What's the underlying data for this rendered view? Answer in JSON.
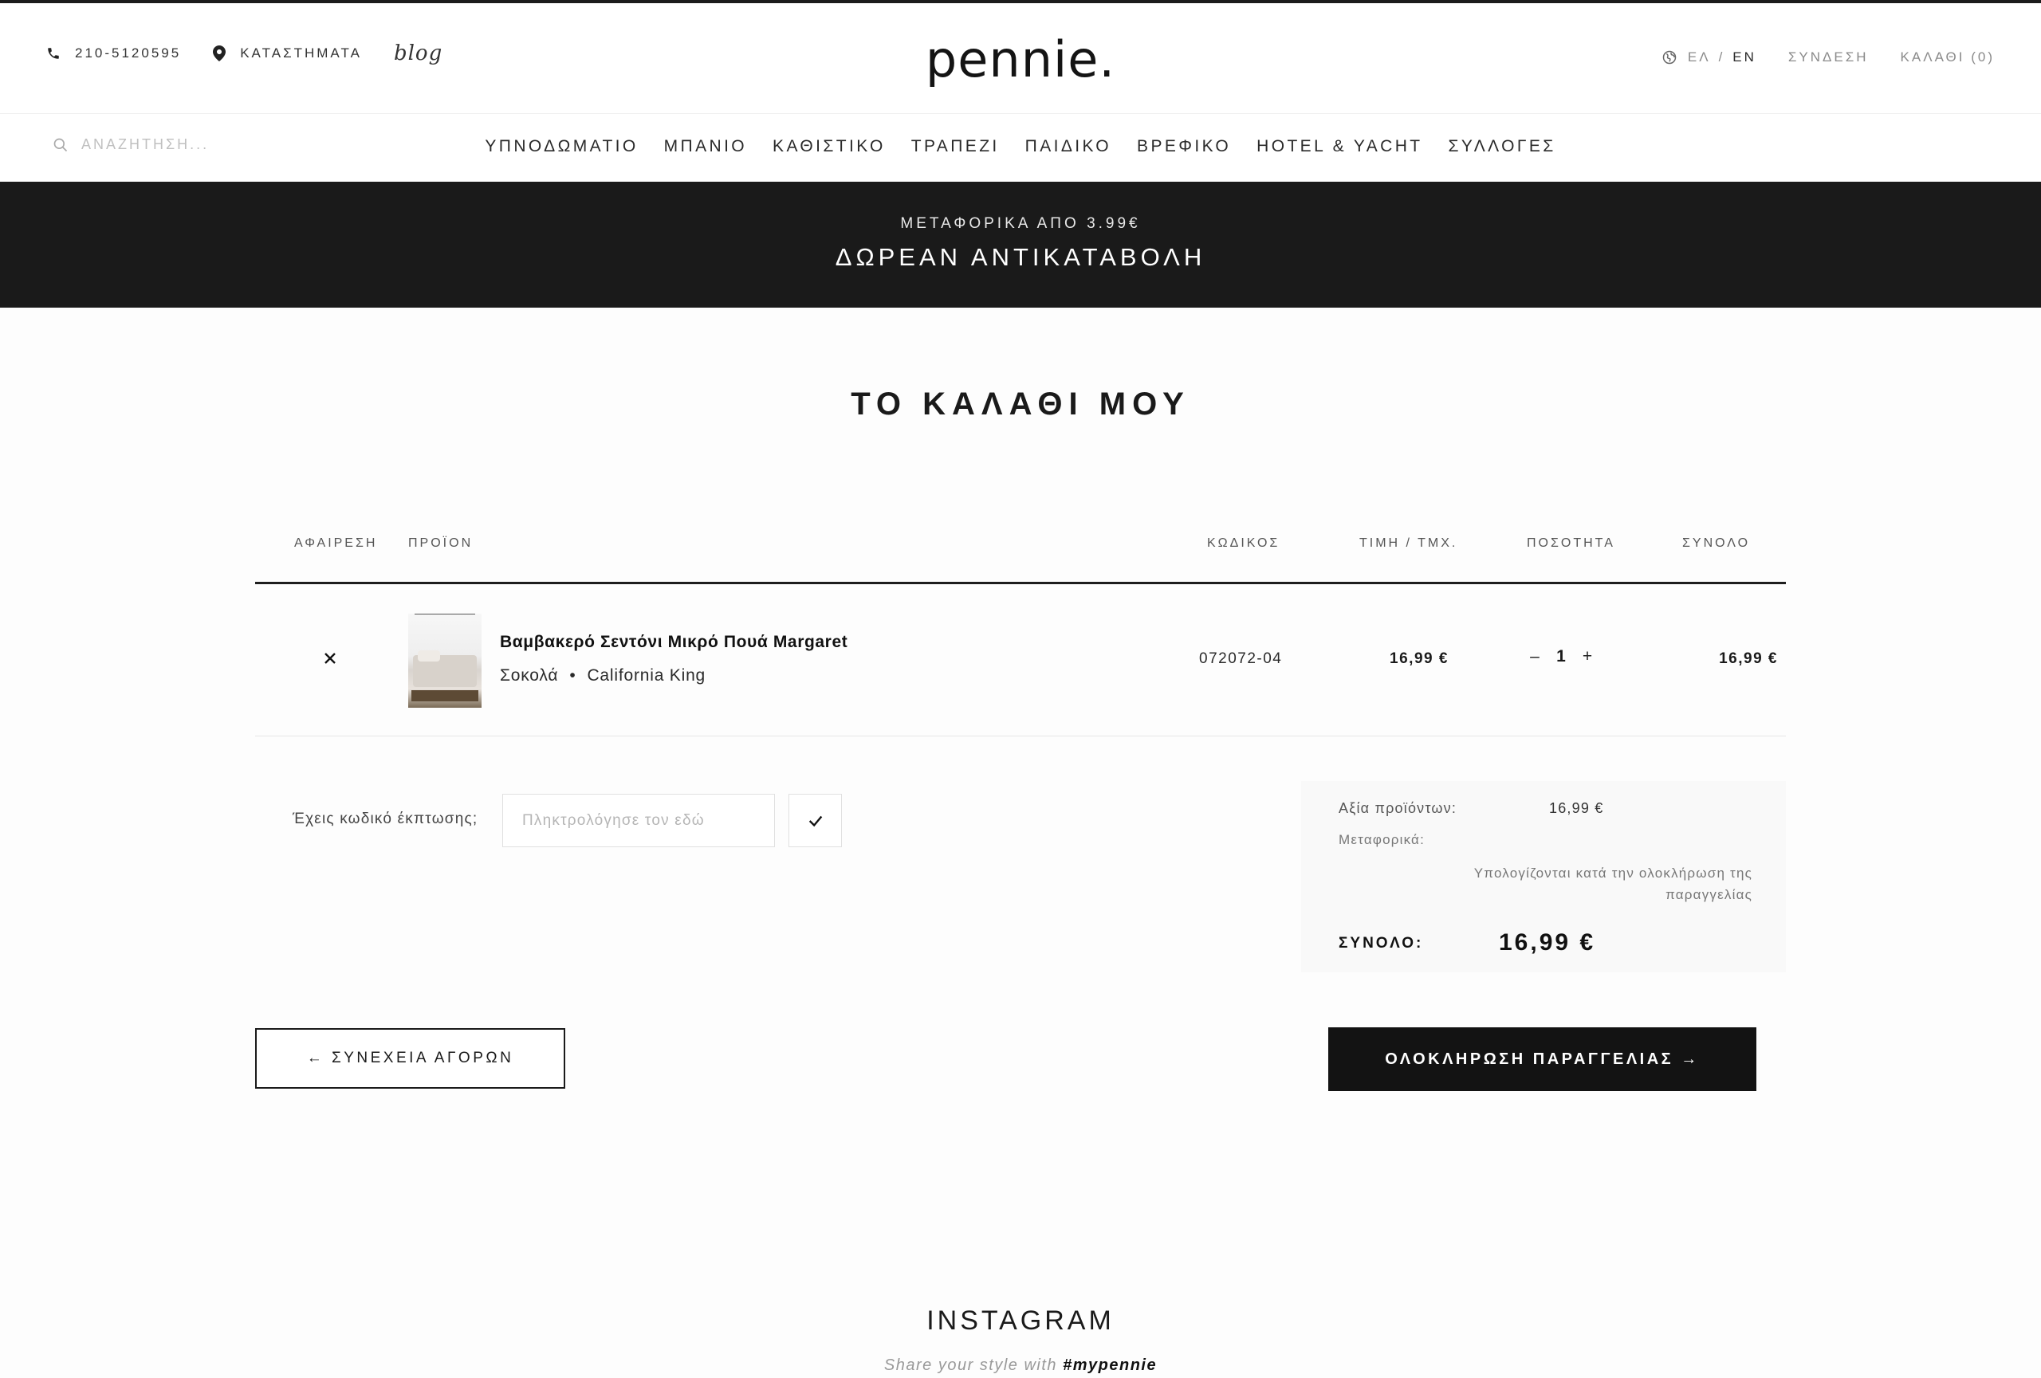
{
  "header": {
    "phone": "210-5120595",
    "stores_label": "ΚΑΤΑΣΤΗΜΑΤΑ",
    "blog_label": "blog",
    "logo": "pennie.",
    "lang_el": "ΕΛ",
    "lang_sep": "/",
    "lang_en": "EN",
    "login_label": "ΣΥΝΔΕΣΗ",
    "cart_label": "ΚΑΛΑΘΙ (0)"
  },
  "search": {
    "placeholder": "ΑΝΑΖΗΤΗΣΗ..."
  },
  "nav": {
    "items": [
      {
        "label": "ΥΠΝΟΔΩΜΑΤΙΟ"
      },
      {
        "label": "ΜΠΑΝΙΟ"
      },
      {
        "label": "ΚΑΘΙΣΤΙΚΟ"
      },
      {
        "label": "ΤΡΑΠΕΖΙ"
      },
      {
        "label": "ΠΑΙΔΙΚΟ"
      },
      {
        "label": "ΒΡΕΦΙΚΟ"
      },
      {
        "label": "HOTEL & YACHT"
      },
      {
        "label": "ΣΥΛΛΟΓΕΣ"
      }
    ]
  },
  "banner": {
    "line1": "ΜΕΤΑΦΟΡΙΚΑ ΑΠΟ 3.99€",
    "line2": "ΔΩΡΕΑΝ ΑΝΤΙΚΑΤΑΒΟΛΗ"
  },
  "page_title": "ΤΟ ΚΑΛΑΘΙ ΜΟΥ",
  "table": {
    "headers": {
      "remove": "ΑΦΑΙΡΕΣΗ",
      "product": "ΠΡΟΪΟΝ",
      "code": "ΚΩΔΙΚΟΣ",
      "unit_price": "ΤΙΜΗ / ΤΜΧ.",
      "quantity": "ΠΟΣΟΤΗΤΑ",
      "total": "ΣΥΝΟΛΟ"
    },
    "rows": [
      {
        "name": "Βαμβακερό Σεντόνι Μικρό Πουά Margaret",
        "color": "Σοκολά",
        "bullet": "•",
        "size": "California King",
        "code": "072072-04",
        "price": "16,99 €",
        "quantity": "1",
        "minus": "–",
        "plus": "+",
        "total": "16,99 €"
      }
    ]
  },
  "coupon": {
    "label": "Έχεις κωδικό έκπτωσης;",
    "placeholder": "Πληκτρολόγησε τον εδώ"
  },
  "summary": {
    "products_label": "Αξία προϊόντων:",
    "products_value": "16,99 €",
    "shipping_label": "Μεταφορικά:",
    "shipping_note": "Υπολογίζονται κατά την ολοκλήρωση της παραγγελίας",
    "total_label": "ΣΥΝΟΛΟ:",
    "total_value": "16,99 €"
  },
  "buttons": {
    "continue": "← ΣΥΝΕΧΕΙΑ ΑΓΟΡΩΝ",
    "checkout": "ΟΛΟΚΛΗΡΩΣΗ ΠΑΡΑΓΓΕΛΙΑΣ →"
  },
  "instagram": {
    "title": "INSTAGRAM",
    "subtitle": "Share your style with",
    "hashtag": "#mypennie"
  },
  "icons": {
    "phone": "phone-icon",
    "stores": "location-pin-icon",
    "language": "globe-icon",
    "search": "search-icon",
    "remove": "close-icon",
    "apply_coupon": "checkmark-icon"
  }
}
